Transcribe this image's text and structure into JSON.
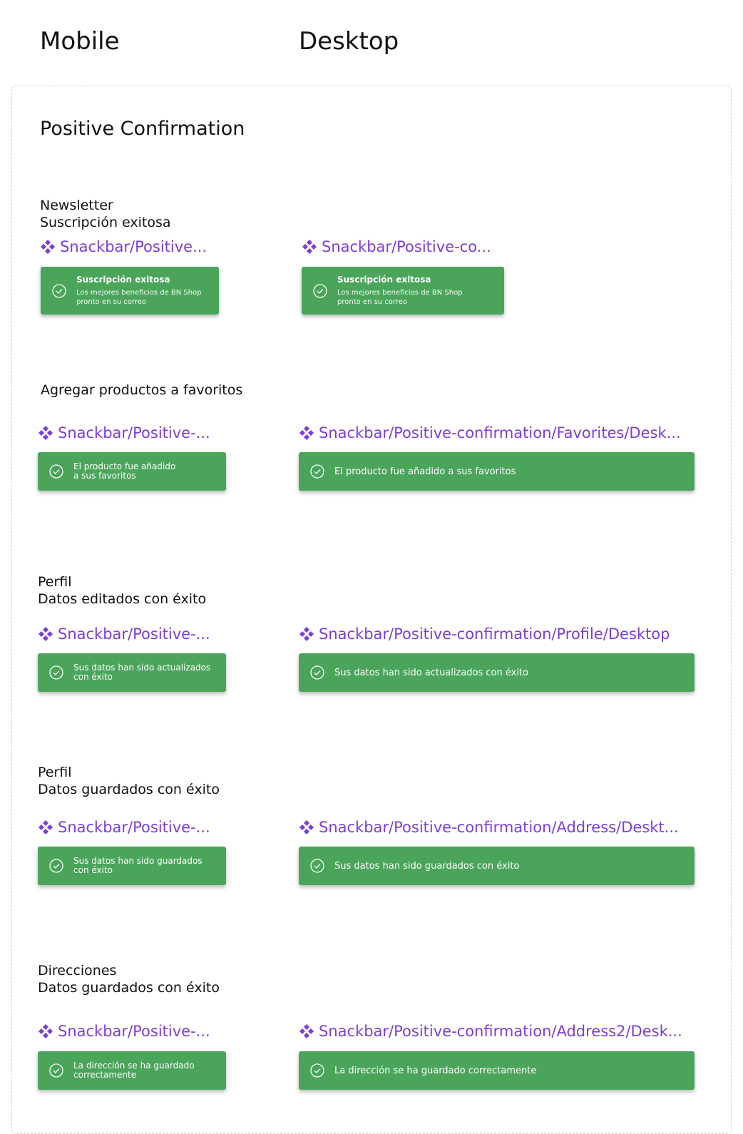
{
  "headers": {
    "mobile": "Mobile",
    "desktop": "Desktop"
  },
  "section_title": "Positive Confirmation",
  "colors": {
    "snackbar": "#4aa55b",
    "component_link": "#7d3cdf"
  },
  "icons": {
    "component": "component-instance-icon",
    "check": "check-circle-icon"
  },
  "groups": [
    {
      "label_lines": [
        "Newsletter",
        "Suscripción exitosa"
      ],
      "mobile_component": "Snackbar/Positive...",
      "desktop_component": "Snackbar/Positive-co...",
      "mobile_snackbar": {
        "title": "Suscripción exitosa",
        "body_lines": [
          "Los mejores beneficios de BN Shop",
          "pronto en su correo"
        ]
      },
      "desktop_snackbar": {
        "title": "Suscripción exitosa",
        "body_lines": [
          "Los mejores beneficios de BN Shop",
          "pronto en su correo"
        ]
      }
    },
    {
      "label_lines": [
        "Agregar productos a favoritos"
      ],
      "mobile_component": "Snackbar/Positive-...",
      "desktop_component": "Snackbar/Positive-confirmation/Favorites/Desk...",
      "mobile_snackbar": {
        "lines": [
          "El producto fue añadido",
          "a sus favoritos"
        ]
      },
      "desktop_snackbar": {
        "message": "El producto fue añadido a sus favoritos"
      }
    },
    {
      "label_lines": [
        "Perfil",
        "Datos editados con éxito"
      ],
      "mobile_component": "Snackbar/Positive-...",
      "desktop_component": "Snackbar/Positive-confirmation/Profile/Desktop",
      "mobile_snackbar": {
        "lines": [
          "Sus datos han sido actualizados",
          "con éxito"
        ]
      },
      "desktop_snackbar": {
        "message": "Sus datos han sido actualizados con éxito"
      }
    },
    {
      "label_lines": [
        "Perfil",
        "Datos guardados con éxito"
      ],
      "mobile_component": "Snackbar/Positive-...",
      "desktop_component": "Snackbar/Positive-confirmation/Address/Deskt...",
      "mobile_snackbar": {
        "lines": [
          "Sus datos han sido guardados",
          "con éxito"
        ]
      },
      "desktop_snackbar": {
        "message": "Sus datos han sido guardados con éxito"
      }
    },
    {
      "label_lines": [
        "Direcciones",
        "Datos guardados con éxito"
      ],
      "mobile_component": "Snackbar/Positive-...",
      "desktop_component": "Snackbar/Positive-confirmation/Address2/Desk...",
      "mobile_snackbar": {
        "lines": [
          "La dirección se ha guardado",
          "correctamente"
        ]
      },
      "desktop_snackbar": {
        "message": "La dirección se ha guardado correctamente"
      }
    }
  ]
}
